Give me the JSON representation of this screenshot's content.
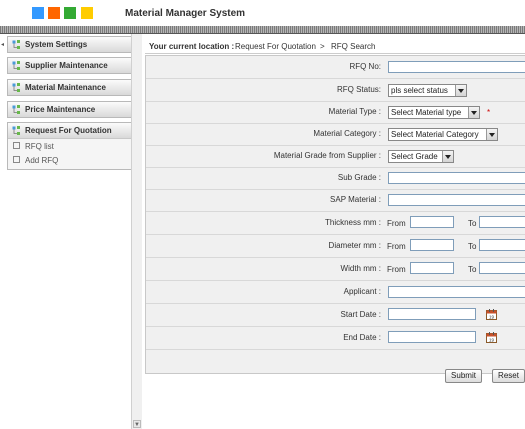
{
  "header": {
    "title": "Material Manager System",
    "logo_colors": [
      "#3399ff",
      "#ff6600",
      "#33aa33",
      "#ffcc00"
    ]
  },
  "sidebar": {
    "items": [
      {
        "label": "System Settings"
      },
      {
        "label": "Supplier Maintenance"
      },
      {
        "label": "Material Maintenance"
      },
      {
        "label": "Price Maintenance"
      }
    ],
    "rfq": {
      "label": "Request For Quotation",
      "subitems": [
        {
          "label": "RFQ list"
        },
        {
          "label": "Add RFQ"
        }
      ]
    }
  },
  "breadcrumb": {
    "prefix": "Your current location :",
    "path1": "Request For Quotation",
    "sep": ">",
    "path2": "RFQ Search"
  },
  "form": {
    "rfq_no": {
      "label": "RFQ No:",
      "value": ""
    },
    "rfq_status": {
      "label": "RFQ Status:",
      "value": "pls select status"
    },
    "material_type": {
      "label": "Material Type :",
      "value": "Select Material type",
      "required": "*"
    },
    "material_category": {
      "label": "Material Category :",
      "value": "Select Material Category"
    },
    "material_grade": {
      "label": "Material Grade from Supplier :",
      "value": "Select Grade"
    },
    "sub_grade": {
      "label": "Sub Grade :",
      "value": ""
    },
    "sap_material": {
      "label": "SAP Material :",
      "value": ""
    },
    "thickness": {
      "label": "Thickness mm :",
      "from": "From",
      "to": "To"
    },
    "diameter": {
      "label": "Diameter mm :",
      "from": "From",
      "to": "To"
    },
    "width": {
      "label": "Width mm :",
      "from": "From",
      "to": "To"
    },
    "applicant": {
      "label": "Applicant :",
      "value": ""
    },
    "start_date": {
      "label": "Start Date :",
      "value": ""
    },
    "end_date": {
      "label": "End Date :",
      "value": ""
    }
  },
  "buttons": {
    "submit": "Submit",
    "reset": "Reset"
  },
  "icons": {
    "menu": "tree-folder-icon",
    "calendar": "calendar-icon",
    "collapse": "collapse-arrow-icon",
    "scroll_down": "scroll-down-arrow-icon"
  }
}
